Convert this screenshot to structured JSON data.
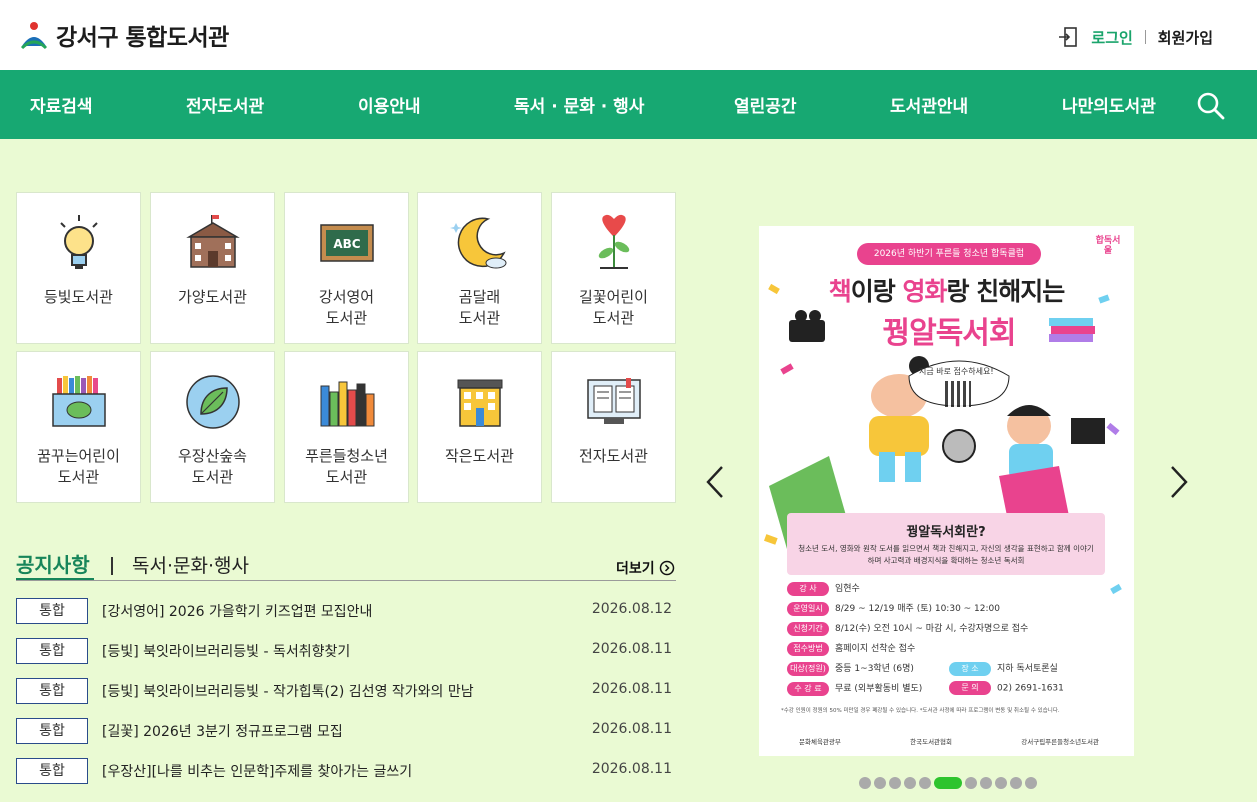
{
  "header": {
    "logo_text": "강서구 통합도서관",
    "login_label": "로그인",
    "join_label": "회원가입"
  },
  "nav": {
    "items": [
      {
        "label": "자료검색"
      },
      {
        "label": "전자도서관"
      },
      {
        "label": "이용안내"
      },
      {
        "label": "독서 · 문화 · 행사"
      },
      {
        "label": "열린공간"
      },
      {
        "label": "도서관안내"
      },
      {
        "label": "나만의도서관"
      }
    ]
  },
  "libraries": [
    {
      "label": "등빛도서관",
      "icon": "lightbulb-icon"
    },
    {
      "label": "가양도서관",
      "icon": "school-building-icon"
    },
    {
      "label": "강서영어\n도서관",
      "icon": "abc-board-icon"
    },
    {
      "label": "곰달래\n도서관",
      "icon": "crescent-moon-icon"
    },
    {
      "label": "길꽃어린이\n도서관",
      "icon": "heart-flower-icon"
    },
    {
      "label": "꿈꾸는어린이\n도서관",
      "icon": "crayon-box-icon"
    },
    {
      "label": "우장산숲속\n도서관",
      "icon": "leaf-icon"
    },
    {
      "label": "푸른들청소년\n도서관",
      "icon": "books-icon"
    },
    {
      "label": "작은도서관",
      "icon": "small-building-icon"
    },
    {
      "label": "전자도서관",
      "icon": "e-book-screen-icon"
    }
  ],
  "notice": {
    "tab_notice": "공지사항",
    "tab_event": "독서·문화·행사",
    "more_label": "더보기",
    "rows": [
      {
        "badge": "통합",
        "title": "[강서영어] 2026 가을학기 키즈업편 모집안내",
        "date": "2026.08.12"
      },
      {
        "badge": "통합",
        "title": "[등빛] 북잇라이브러리등빛 - 독서취향찾기",
        "date": "2026.08.11"
      },
      {
        "badge": "통합",
        "title": "[등빛] 북잇라이브러리등빛 - 작가힙톡(2) 김선영 작가와의 만남",
        "date": "2026.08.11"
      },
      {
        "badge": "통합",
        "title": "[길꽃] 2026년 3분기 정규프로그램 모집",
        "date": "2026.08.11"
      },
      {
        "badge": "통합",
        "title": "[우장산][나를 비추는 인문학]주제를 찾아가는 글쓰기",
        "date": "2026.08.11"
      }
    ]
  },
  "poster": {
    "pill": "2026년 하반기 푸른들 청소년 합독클럽",
    "brand": "합독서울",
    "headline_a": "책",
    "headline_b": "이랑 ",
    "headline_c": "영화",
    "headline_d": "랑 친해지는",
    "headline_2": "꿩알독서회",
    "qr_text": "지금 바로 접수하세요!",
    "info_title": "꿩알독서회란?",
    "info_body": "청소년 도서, 영화와 원작 도서를 읽으면서 책과 친해지고, 자신의 생각을 표현하고 함께 이야기하며 사고력과 배경지식을 확대하는 청소년 독서회",
    "lines": [
      {
        "key": "강 사",
        "value": "임현수"
      },
      {
        "key": "운영일시",
        "value": "8/29 ~ 12/19 매주 (토) 10:30 ~ 12:00"
      },
      {
        "key": "신청기간",
        "value": "8/12(수) 오전 10시 ~ 마감 시, 수강자명으로 접수"
      },
      {
        "key": "접수방법",
        "value": "홈페이지 선착순 접수"
      },
      {
        "key": "대상(정원)",
        "value": "중등 1~3학년 (6명)"
      },
      {
        "key": "수 강 료",
        "value": "무료 (외부활동비 별도)"
      }
    ],
    "place_key": "장 소",
    "place_value": "지하 독서토론실",
    "contact_key": "문 의",
    "contact_value": "02) 2691-1631",
    "foot": "*수강 인원이 정원의 50% 미만일 경우 폐강될 수 있습니다. *도서관 사정에 따라 프로그램이 변동 및 취소될 수 있습니다.",
    "logo_1": "문화체육관광부",
    "logo_2": "한국도서관협회",
    "logo_3": "강서구립푸른들청소년도서관"
  },
  "carousel": {
    "dot_count": 11,
    "active_index": 5
  },
  "colors": {
    "nav_green": "#17a872",
    "page_bg": "#eafad3",
    "accent_pink": "#e9438e",
    "badge_border": "#2a4c8a"
  }
}
